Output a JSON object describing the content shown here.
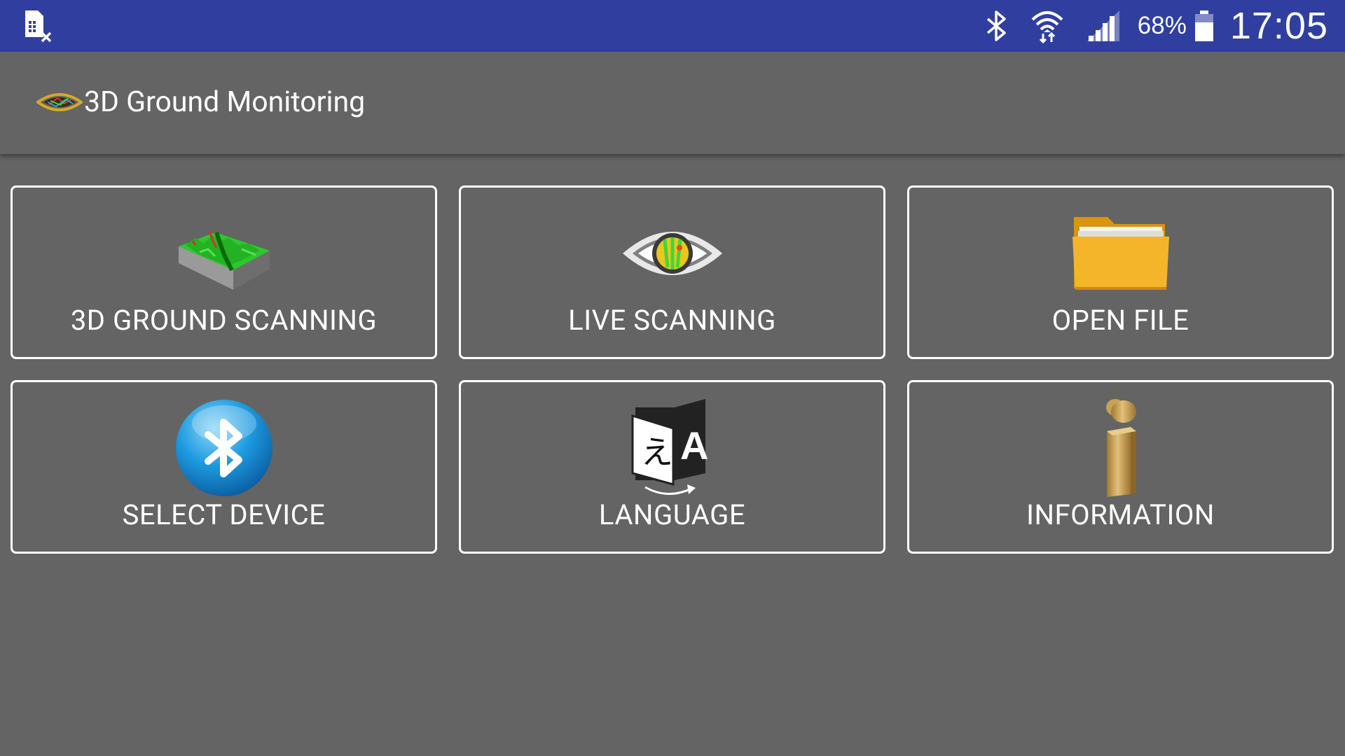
{
  "status_bar": {
    "battery_percent": "68%",
    "time": "17:05"
  },
  "app_bar": {
    "title": "3D Ground Monitoring"
  },
  "menu": {
    "items": [
      {
        "label": "3D GROUND SCANNING",
        "icon": "terrain-3d-icon"
      },
      {
        "label": "LIVE SCANNING",
        "icon": "eye-icon"
      },
      {
        "label": "OPEN FILE",
        "icon": "folder-icon"
      },
      {
        "label": "SELECT DEVICE",
        "icon": "bluetooth-icon"
      },
      {
        "label": "LANGUAGE",
        "icon": "translate-icon"
      },
      {
        "label": "INFORMATION",
        "icon": "info-icon"
      }
    ]
  },
  "colors": {
    "status_bar": "#303F9F",
    "background": "#646464",
    "tile_border": "#FFFFFF"
  }
}
